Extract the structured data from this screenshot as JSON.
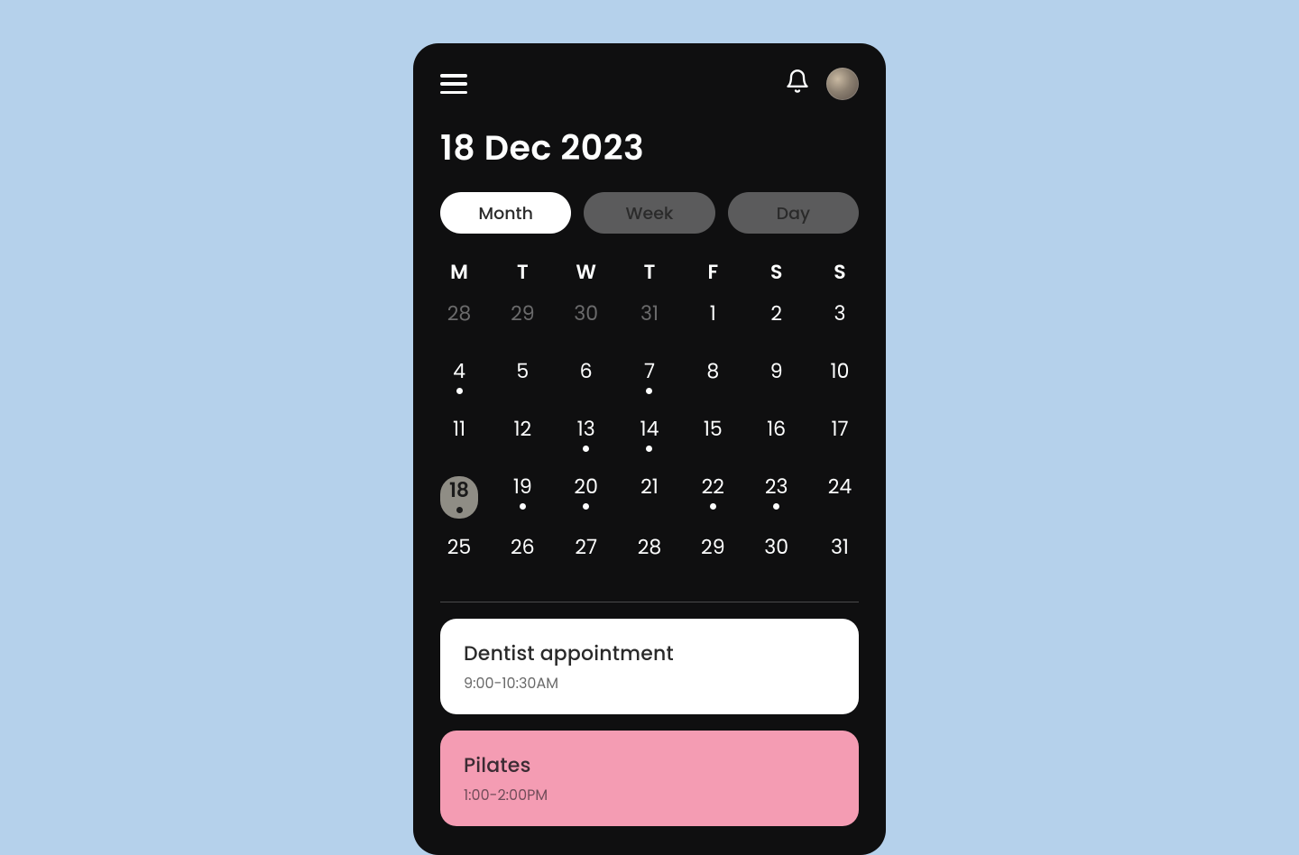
{
  "header": {
    "title": "18 Dec 2023"
  },
  "tabs": {
    "month": "Month",
    "week": "Week",
    "day": "Day",
    "active": "month"
  },
  "calendar": {
    "weekdays": [
      "M",
      "T",
      "W",
      "T",
      "F",
      "S",
      "S"
    ],
    "weeks": [
      [
        {
          "num": "28",
          "muted": true,
          "dot": false,
          "selected": false
        },
        {
          "num": "29",
          "muted": true,
          "dot": false,
          "selected": false
        },
        {
          "num": "30",
          "muted": true,
          "dot": false,
          "selected": false
        },
        {
          "num": "31",
          "muted": true,
          "dot": false,
          "selected": false
        },
        {
          "num": "1",
          "muted": false,
          "dot": false,
          "selected": false
        },
        {
          "num": "2",
          "muted": false,
          "dot": false,
          "selected": false
        },
        {
          "num": "3",
          "muted": false,
          "dot": false,
          "selected": false
        }
      ],
      [
        {
          "num": "4",
          "muted": false,
          "dot": true,
          "selected": false
        },
        {
          "num": "5",
          "muted": false,
          "dot": false,
          "selected": false
        },
        {
          "num": "6",
          "muted": false,
          "dot": false,
          "selected": false
        },
        {
          "num": "7",
          "muted": false,
          "dot": true,
          "selected": false
        },
        {
          "num": "8",
          "muted": false,
          "dot": false,
          "selected": false
        },
        {
          "num": "9",
          "muted": false,
          "dot": false,
          "selected": false
        },
        {
          "num": "10",
          "muted": false,
          "dot": false,
          "selected": false
        }
      ],
      [
        {
          "num": "11",
          "muted": false,
          "dot": false,
          "selected": false
        },
        {
          "num": "12",
          "muted": false,
          "dot": false,
          "selected": false
        },
        {
          "num": "13",
          "muted": false,
          "dot": true,
          "selected": false
        },
        {
          "num": "14",
          "muted": false,
          "dot": true,
          "selected": false
        },
        {
          "num": "15",
          "muted": false,
          "dot": false,
          "selected": false
        },
        {
          "num": "16",
          "muted": false,
          "dot": false,
          "selected": false
        },
        {
          "num": "17",
          "muted": false,
          "dot": false,
          "selected": false
        }
      ],
      [
        {
          "num": "18",
          "muted": false,
          "dot": true,
          "selected": true
        },
        {
          "num": "19",
          "muted": false,
          "dot": true,
          "selected": false
        },
        {
          "num": "20",
          "muted": false,
          "dot": true,
          "selected": false
        },
        {
          "num": "21",
          "muted": false,
          "dot": false,
          "selected": false
        },
        {
          "num": "22",
          "muted": false,
          "dot": true,
          "selected": false
        },
        {
          "num": "23",
          "muted": false,
          "dot": true,
          "selected": false
        },
        {
          "num": "24",
          "muted": false,
          "dot": false,
          "selected": false
        }
      ],
      [
        {
          "num": "25",
          "muted": false,
          "dot": false,
          "selected": false
        },
        {
          "num": "26",
          "muted": false,
          "dot": false,
          "selected": false
        },
        {
          "num": "27",
          "muted": false,
          "dot": false,
          "selected": false
        },
        {
          "num": "28",
          "muted": false,
          "dot": false,
          "selected": false
        },
        {
          "num": "29",
          "muted": false,
          "dot": false,
          "selected": false
        },
        {
          "num": "30",
          "muted": false,
          "dot": false,
          "selected": false
        },
        {
          "num": "31",
          "muted": false,
          "dot": false,
          "selected": false
        }
      ]
    ]
  },
  "events": [
    {
      "title": "Dentist appointment",
      "time": "9:00-10:30AM",
      "color": "white"
    },
    {
      "title": "Pilates",
      "time": "1:00-2:00PM",
      "color": "pink"
    }
  ]
}
